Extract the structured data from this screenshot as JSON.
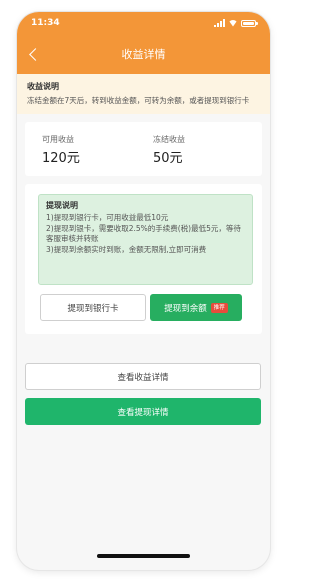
{
  "status_bar": {
    "time": "11:34"
  },
  "nav": {
    "title": "收益详情"
  },
  "notice": {
    "title": "收益说明",
    "text": "冻结金额在7天后，转到收益金额，可转为余额，或者提现到银行卡"
  },
  "earnings": {
    "available_label": "可用收益",
    "available_value": "120元",
    "frozen_label": "冻结收益",
    "frozen_value": "50元"
  },
  "withdraw_rules": {
    "title": "提现说明",
    "lines": [
      "1)提现到银行卡，可用收益最低10元",
      "2)提现到银卡，需要收取2.5%的手续费(税)最低5元，等待客服审核并转账",
      "3)提现到余额实时到账，金额无限制,立即可消费"
    ]
  },
  "buttons": {
    "withdraw_bank": "提现到银行卡",
    "withdraw_balance": "提现到余额",
    "recommend_tag": "推荐",
    "view_earnings": "查看收益详情",
    "view_withdrawals": "查看提现详情"
  },
  "colors": {
    "header": "#f39638",
    "primary_green": "#1fb56b",
    "notice_bg": "#fdf4e2",
    "rules_bg": "#ddf1e0"
  },
  "icons": [
    "back-arrow-icon",
    "signal-icon",
    "wifi-icon",
    "battery-icon"
  ]
}
